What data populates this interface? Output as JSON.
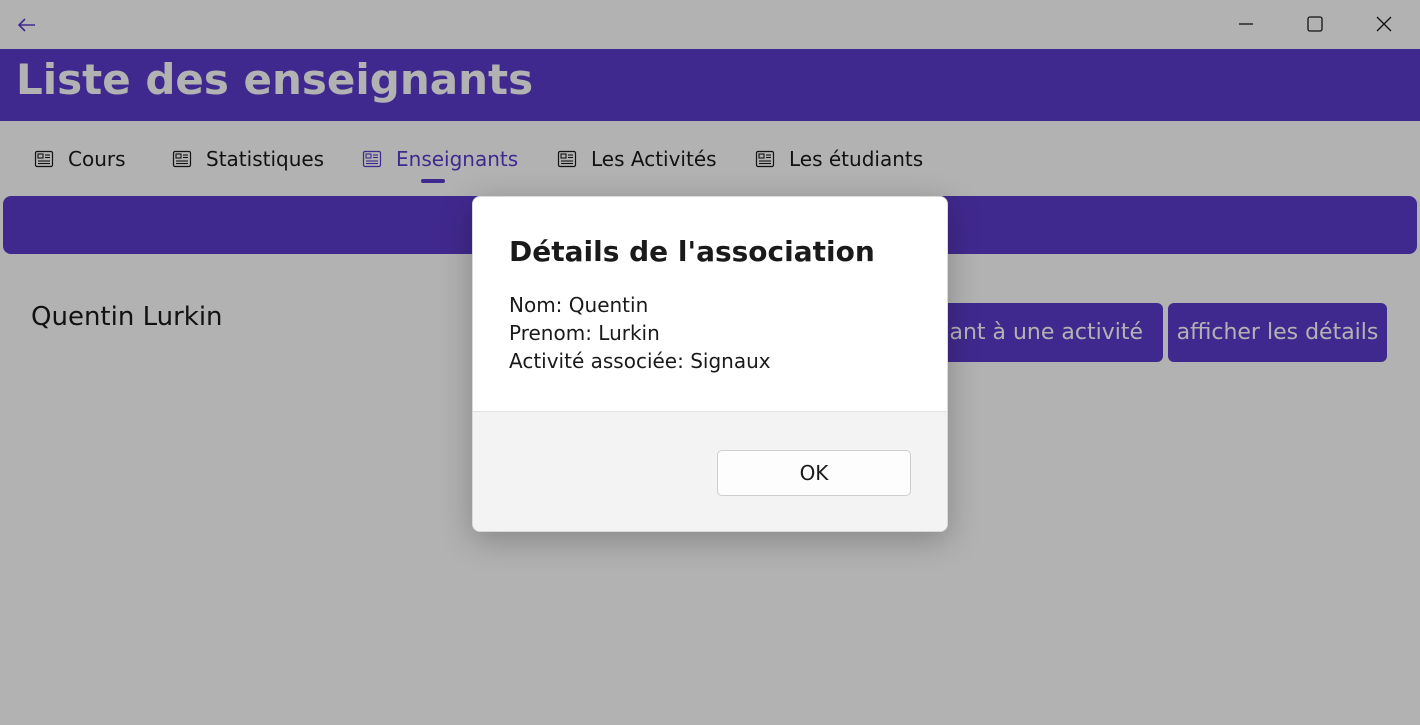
{
  "window": {
    "back_icon": "arrow-left-icon",
    "minimize_icon": "minimize-icon",
    "maximize_icon": "maximize-icon",
    "close_icon": "close-icon"
  },
  "header": {
    "title": "Liste des enseignants"
  },
  "tabs": [
    {
      "label": "Cours",
      "icon": "newspaper-icon"
    },
    {
      "label": "Statistiques",
      "icon": "newspaper-icon"
    },
    {
      "label": "Enseignants",
      "icon": "newspaper-icon",
      "active": true
    },
    {
      "label": "Les Activités",
      "icon": "newspaper-icon"
    },
    {
      "label": "Les étudiants",
      "icon": "newspaper-icon"
    }
  ],
  "teacher": {
    "name": "Quentin Lurkin",
    "assign_button": "ignant à une activité",
    "details_button": "afficher les détails"
  },
  "dialog": {
    "title": "Détails de l'association",
    "nom": "Nom: Quentin",
    "prenom": "Prenom: Lurkin",
    "activite": "Activité associée: Signaux",
    "ok_label": "OK"
  },
  "colors": {
    "accent": "#5c3ccc",
    "overlay": "rgba(0,0,0,0.30)"
  }
}
